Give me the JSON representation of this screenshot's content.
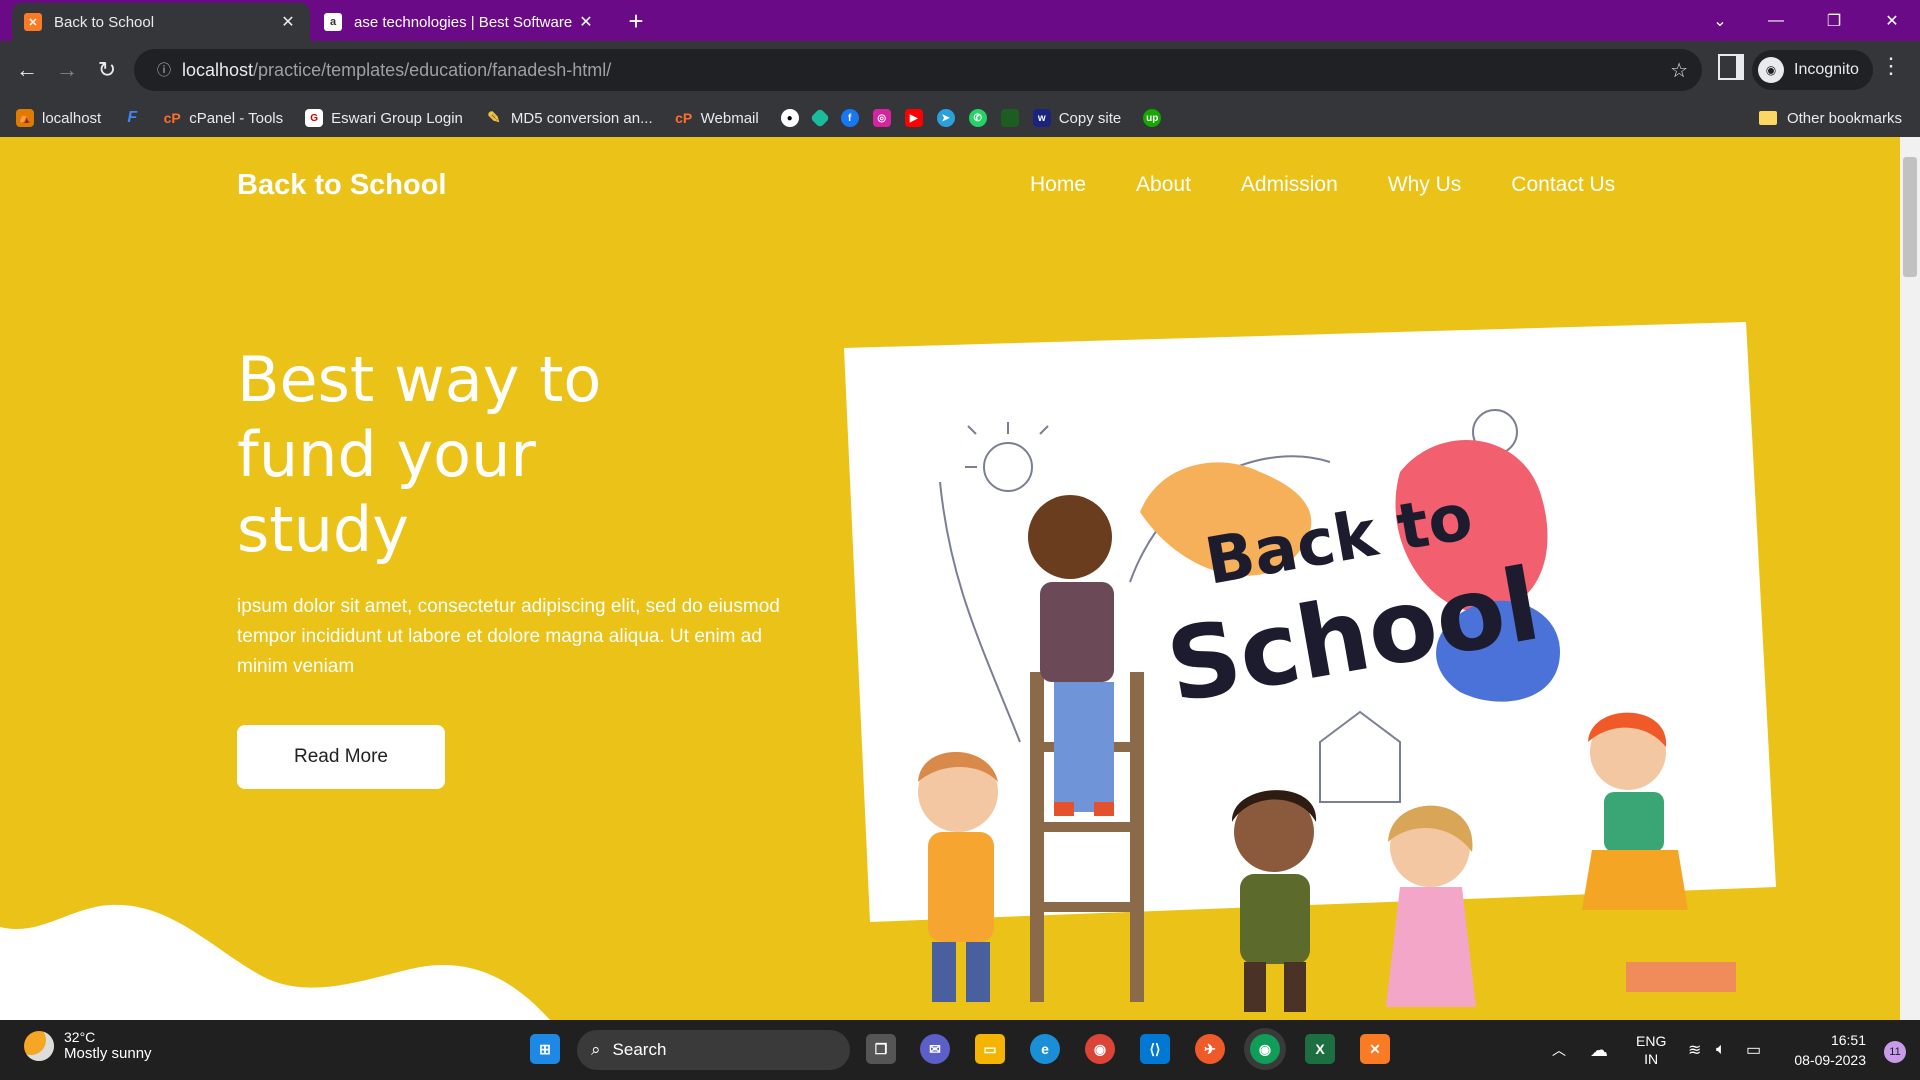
{
  "browser": {
    "tabs": [
      {
        "title": "Back to School",
        "active": true
      },
      {
        "title": "ase technologies | Best Software",
        "active": false
      }
    ],
    "new_tab_icon": "+",
    "address": {
      "host": "localhost",
      "path": "/practice/templates/education/fanadesh-html/"
    },
    "profile_label": "Incognito",
    "bookmarks": [
      {
        "label": "localhost"
      },
      {
        "label": ""
      },
      {
        "label": "cPanel - Tools"
      },
      {
        "label": "Eswari Group Login"
      },
      {
        "label": "MD5 conversion an..."
      },
      {
        "label": "Webmail"
      },
      {
        "label": "Copy site"
      }
    ],
    "other_bookmarks": "Other bookmarks"
  },
  "site": {
    "brand": "Back to School",
    "nav": [
      "Home",
      "About",
      "Admission",
      "Why Us",
      "Contact Us"
    ],
    "hero": {
      "title_lines": [
        "Best way to",
        "fund your",
        "study"
      ],
      "text": "ipsum dolor sit amet, consectetur adipiscing elit, sed do eiusmod tempor incididunt ut labore et dolore magna aliqua. Ut enim ad minim veniam",
      "button": "Read More"
    },
    "illustration_text": [
      "Back to",
      "School"
    ],
    "colors": {
      "background": "#ebc218",
      "text": "#ffffff"
    }
  },
  "taskbar": {
    "weather": {
      "temp": "32°C",
      "desc": "Mostly sunny"
    },
    "search_placeholder": "Search",
    "lang": [
      "ENG",
      "IN"
    ],
    "time": "16:51",
    "date": "08-09-2023",
    "notifications": "11"
  }
}
